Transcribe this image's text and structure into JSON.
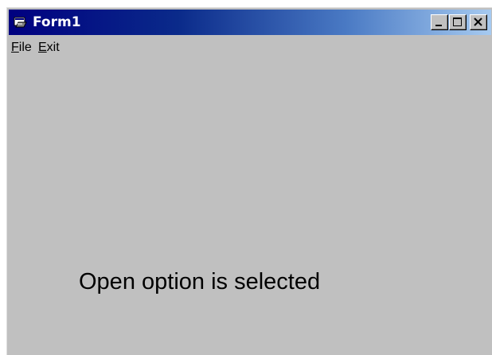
{
  "window": {
    "title": "Form1",
    "icon": "form-app-icon",
    "caption_buttons": [
      "minimize-icon",
      "maximize-icon",
      "close-icon"
    ]
  },
  "menu": {
    "items": [
      {
        "first": "F",
        "rest": "ile",
        "label": "File"
      },
      {
        "first": "E",
        "rest": "xit",
        "label": "Exit"
      }
    ]
  },
  "content": {
    "status_label": "Open option is selected"
  },
  "colors": {
    "titlebar_start": "#000080",
    "titlebar_end": "#a6caf0",
    "window_face": "#c0c0c0",
    "title_text": "#ffffff"
  }
}
